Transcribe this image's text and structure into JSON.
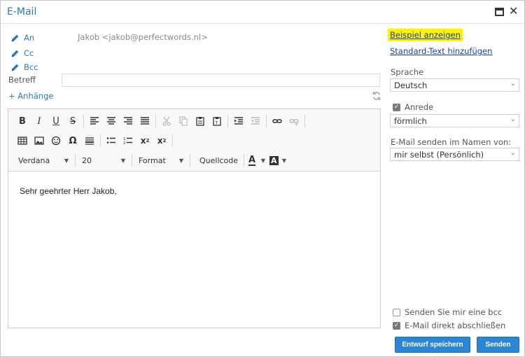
{
  "window": {
    "title": "E-Mail"
  },
  "recipients": {
    "to_label": "An",
    "cc_label": "Cc",
    "bcc_label": "Bcc",
    "to_value": "Jakob <jakob@perfectwords.nl>"
  },
  "subject": {
    "label": "Betreff",
    "value": ""
  },
  "attachments_label": "+ Anhänge",
  "toolbar": {
    "font_family": "Verdana",
    "font_size": "20",
    "format_label": "Format",
    "source_label": "Quellcode",
    "text_color_glyph": "A",
    "bg_color_glyph": "A"
  },
  "body_text": "Sehr geehrter Herr Jakob,",
  "side": {
    "example_link": "Beispiel anzeigen",
    "standard_text_link": "Standard-Text hinzufügen",
    "language_label": "Sprache",
    "language_value": "Deutsch",
    "salutation_label": "Anrede",
    "salutation_value": "förmlich",
    "send_as_label": "E-Mail senden im Namen von:",
    "send_as_value": "mir selbst (Persönlich)",
    "bcc_me_label": "Senden Sie mir eine bcc",
    "close_email_label": "E-Mail direkt abschließen"
  },
  "checks": {
    "salutation": true,
    "bcc_me": false,
    "close_email": true
  },
  "buttons": {
    "save_draft": "Entwurf speichern",
    "send": "Senden"
  },
  "colors": {
    "accent": "#2a7ab8",
    "button": "#2c86d3",
    "highlight": "#fff200",
    "link": "#1a3fb0"
  }
}
